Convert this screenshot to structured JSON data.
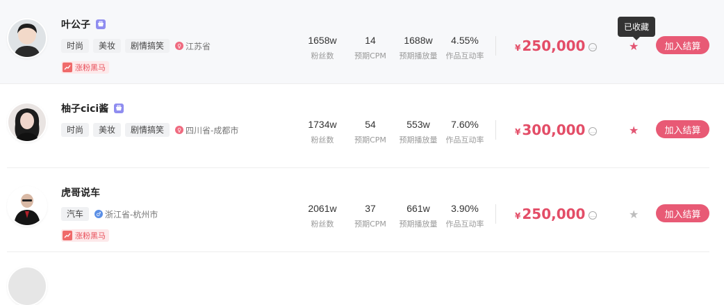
{
  "tooltip": "已收藏",
  "colors": {
    "accent": "#e85a75",
    "price": "#e34d67",
    "star_on": "#e25572",
    "star_off": "#bdbdbd"
  },
  "rows": [
    {
      "name": "叶公子",
      "tags": [
        "时尚",
        "美妆",
        "剧情搞笑"
      ],
      "gender": "female",
      "location": "江苏省",
      "badge": "涨粉黑马",
      "fans": "1658w",
      "fans_label": "粉丝数",
      "cpm": "14",
      "cpm_label": "预期CPM",
      "plays": "1688w",
      "plays_label": "预期播放量",
      "engagement": "4.55%",
      "engagement_label": "作品互动率",
      "currency": "¥",
      "price": "250,000",
      "favorited": true,
      "button": "加入结算"
    },
    {
      "name": "柚子cici酱",
      "tags": [
        "时尚",
        "美妆",
        "剧情搞笑"
      ],
      "gender": "female",
      "location": "四川省-成都市",
      "badge": "",
      "fans": "1734w",
      "fans_label": "粉丝数",
      "cpm": "54",
      "cpm_label": "预期CPM",
      "plays": "553w",
      "plays_label": "预期播放量",
      "engagement": "7.60%",
      "engagement_label": "作品互动率",
      "currency": "¥",
      "price": "300,000",
      "favorited": true,
      "button": "加入结算"
    },
    {
      "name": "虎哥说车",
      "tags": [
        "汽车"
      ],
      "gender": "male",
      "location": "浙江省-杭州市",
      "badge": "涨粉黑马",
      "fans": "2061w",
      "fans_label": "粉丝数",
      "cpm": "37",
      "cpm_label": "预期CPM",
      "plays": "661w",
      "plays_label": "预期播放量",
      "engagement": "3.90%",
      "engagement_label": "作品互动率",
      "currency": "¥",
      "price": "250,000",
      "favorited": false,
      "button": "加入结算"
    }
  ]
}
